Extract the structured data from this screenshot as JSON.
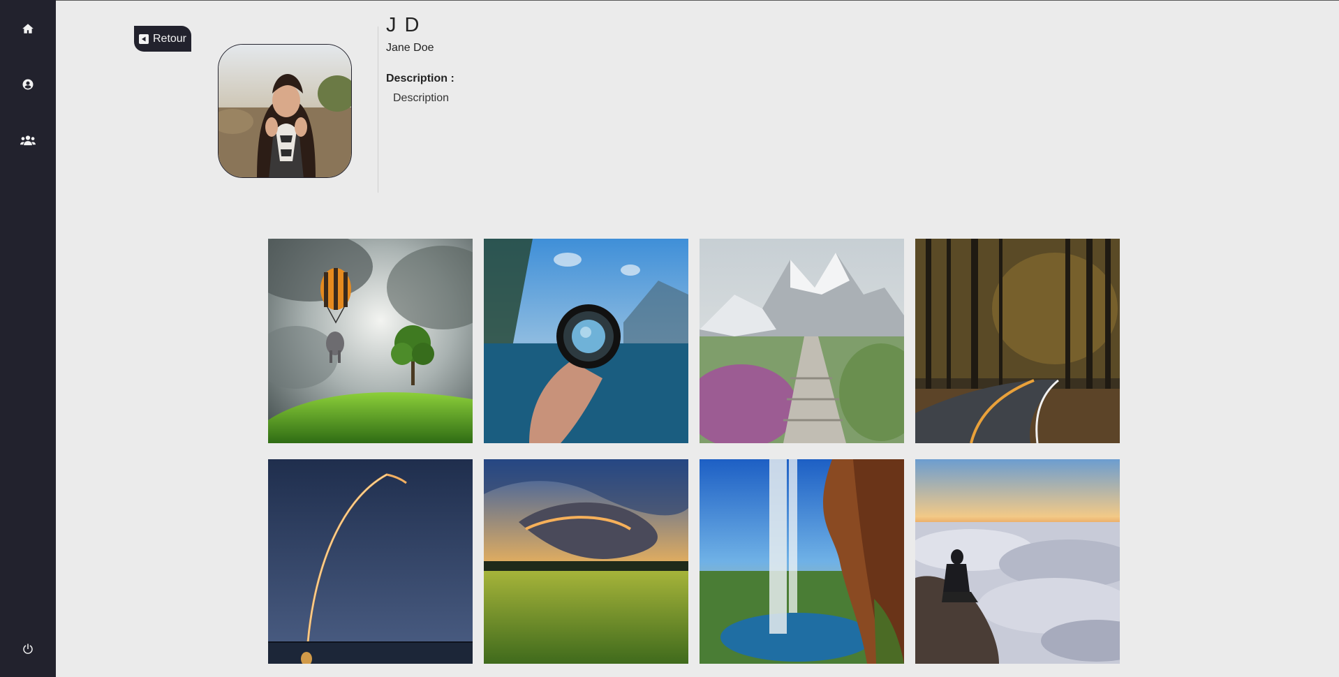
{
  "sidebar": {
    "items": [
      {
        "name": "home",
        "icon": "home-icon"
      },
      {
        "name": "profile",
        "icon": "user-circle-icon"
      },
      {
        "name": "users",
        "icon": "users-icon"
      }
    ],
    "footer": {
      "icon": "power-icon"
    }
  },
  "back_button": {
    "label": "Retour",
    "icon": "caret-left-square-icon"
  },
  "profile": {
    "initials": "J D",
    "name": "Jane Doe",
    "description_label": "Description :",
    "description": "Description",
    "avatar_icon": "avatar-photo"
  },
  "gallery": {
    "images": [
      {
        "subject": "hot-air-balloon-elephant"
      },
      {
        "subject": "lens-lake"
      },
      {
        "subject": "mountain-path"
      },
      {
        "subject": "forest-road"
      },
      {
        "subject": "rocket-launch"
      },
      {
        "subject": "sunset-field"
      },
      {
        "subject": "waterfall-cave"
      },
      {
        "subject": "sea-of-clouds"
      }
    ]
  },
  "colors": {
    "sidebar": "#22222d",
    "background": "#ebebeb",
    "accent": "#22222d"
  }
}
